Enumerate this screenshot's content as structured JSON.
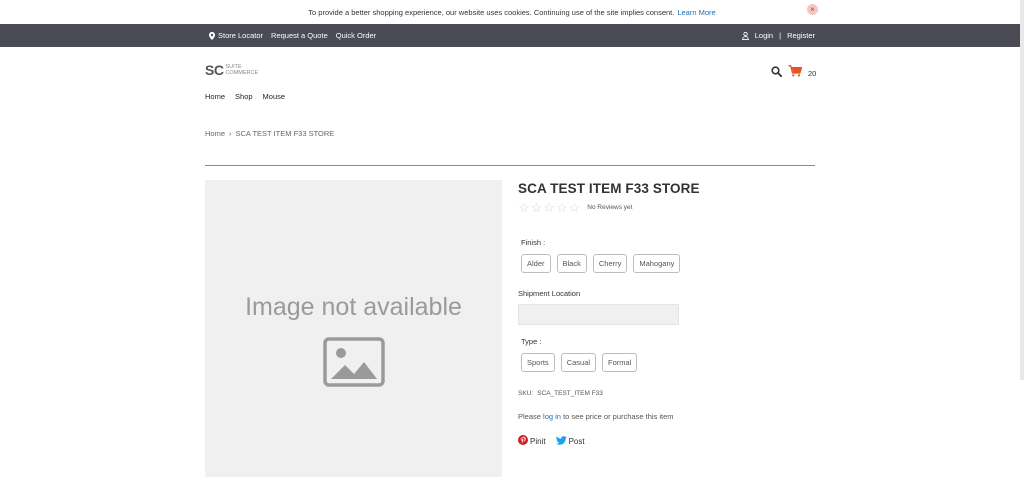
{
  "cookie": {
    "message": "To provide a better shopping experience, our website uses cookies. Continuing use of the site implies consent.",
    "link": "Learn More",
    "close_icon": "close-icon"
  },
  "topbar": {
    "store_locator": "Store Locator",
    "request_quote": "Request a Quote",
    "quick_order": "Quick Order",
    "login": "Login",
    "separator": "|",
    "register": "Register"
  },
  "logo": {
    "main": "SC",
    "sub_line1": "SUITE",
    "sub_line2": "COMMERCE"
  },
  "header": {
    "cart_count": "20",
    "search_icon": "search-icon",
    "cart_icon": "cart-icon"
  },
  "nav": {
    "items": [
      "Home",
      "Shop",
      "Mouse"
    ]
  },
  "breadcrumb": {
    "home": "Home",
    "separator": "›",
    "current": "SCA TEST ITEM F33 STORE"
  },
  "product": {
    "image_placeholder": "Image not available",
    "title": "SCA TEST ITEM F33 STORE",
    "rating_stars": 0,
    "rating_max": 5,
    "reviews_text": "No Reviews yet",
    "finish_label": "Finish :",
    "finish_options": [
      "Alder",
      "Black",
      "Cherry",
      "Mahogany"
    ],
    "shipment_label": "Shipment Location",
    "shipment_value": "",
    "type_label": "Type :",
    "type_options": [
      "Sports",
      "Casual",
      "Formal"
    ],
    "sku_label": "SKU:",
    "sku_value": "SCA_TEST_ITEM F33",
    "login_prefix": "Please",
    "login_link": "log in",
    "login_suffix": "to see price or purchase this item",
    "pinit": "Pinit",
    "post": "Post"
  },
  "colors": {
    "topbar_bg": "#4a4b55",
    "cart_orange": "#e8541e",
    "link_blue": "#1f6fb2",
    "pinterest_red": "#cb2027",
    "twitter_blue": "#1da1f2"
  }
}
